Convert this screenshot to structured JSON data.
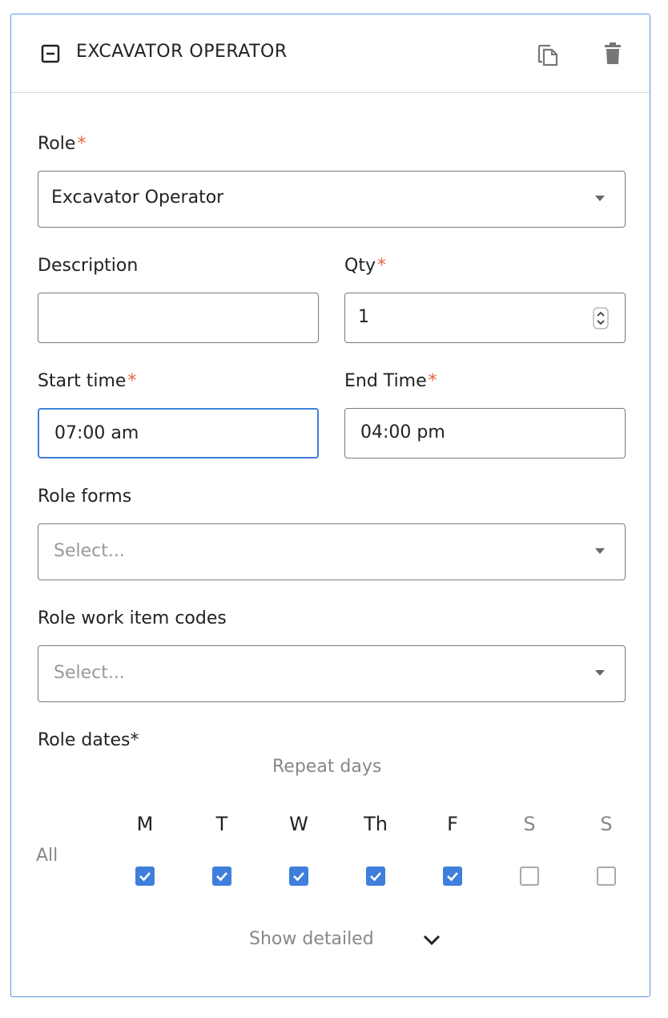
{
  "header": {
    "title": "EXCAVATOR OPERATOR",
    "collapse_icon": "minus-square-icon",
    "copy_icon": "copy-icon",
    "delete_icon": "trash-icon"
  },
  "role": {
    "label": "Role",
    "required_mark": "*",
    "value": "Excavator Operator"
  },
  "description": {
    "label": "Description",
    "value": ""
  },
  "qty": {
    "label": "Qty",
    "required_mark": "*",
    "value": "1"
  },
  "start_time": {
    "label": "Start time",
    "required_mark": "*",
    "value": "07:00 am"
  },
  "end_time": {
    "label": "End Time",
    "required_mark": "*",
    "value": "04:00 pm"
  },
  "role_forms": {
    "label": "Role forms",
    "placeholder": "Select..."
  },
  "role_work_item_codes": {
    "label": "Role work item codes",
    "placeholder": "Select..."
  },
  "role_dates": {
    "label": "Role dates*",
    "repeat_days_label": "Repeat days",
    "all_label": "All",
    "days": [
      {
        "label": "M",
        "checked": true
      },
      {
        "label": "T",
        "checked": true
      },
      {
        "label": "W",
        "checked": true
      },
      {
        "label": "Th",
        "checked": true
      },
      {
        "label": "F",
        "checked": true
      },
      {
        "label": "S",
        "checked": false
      },
      {
        "label": "S",
        "checked": false
      }
    ]
  },
  "show_detailed": {
    "label": "Show detailed",
    "icon": "chevron-down-icon"
  },
  "colors": {
    "accent": "#3f7fdb",
    "required": "#e8623c",
    "border": "#7a7a7a"
  }
}
